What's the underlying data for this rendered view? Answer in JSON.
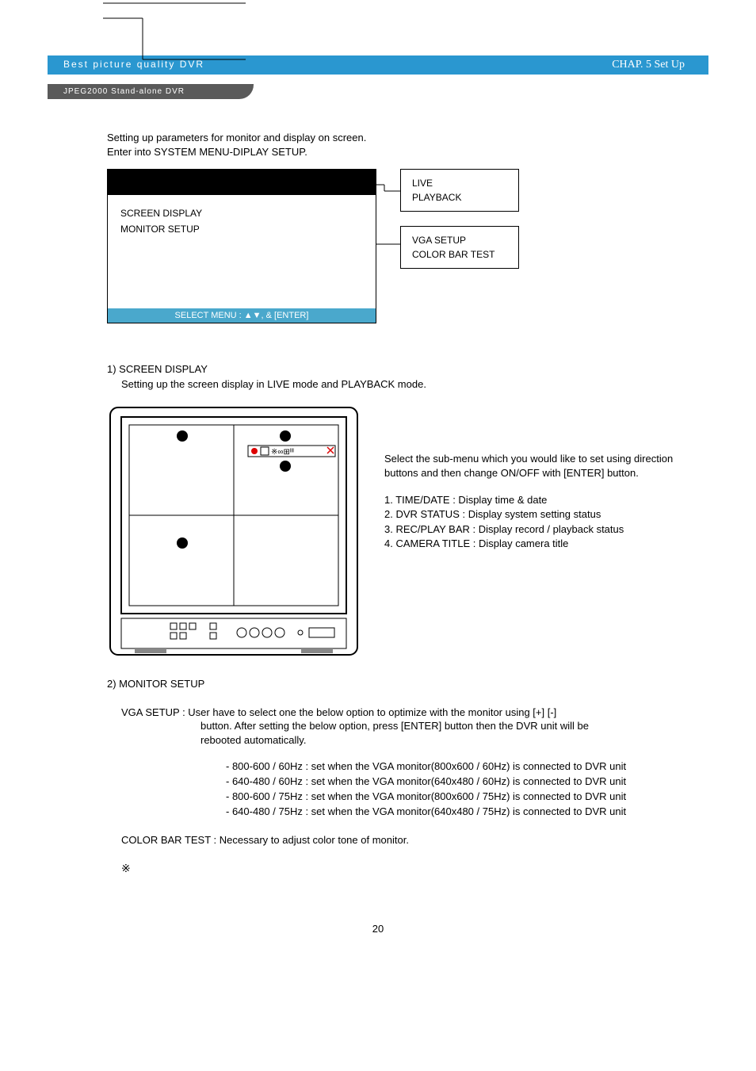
{
  "header": {
    "left": "Best picture quality DVR",
    "right": "CHAP.  5  Set Up",
    "sub": "JPEG2000 Stand-alone DVR"
  },
  "intro": {
    "line1": "Setting up parameters for monitor and display on screen.",
    "line2": "Enter into SYSTEM MENU-DIPLAY SETUP."
  },
  "menu_box": {
    "item1": "SCREEN DISPLAY",
    "item2": "MONITOR SETUP",
    "footer": "SELECT MENU : ▲▼, & [ENTER]"
  },
  "side_box1": {
    "line1": "LIVE",
    "line2": "PLAYBACK"
  },
  "side_box2": {
    "line1": "VGA SETUP",
    "line2": "COLOR BAR TEST"
  },
  "section1": {
    "heading": "1) SCREEN DISPLAY",
    "desc": "Setting up the screen display in LIVE mode and PLAYBACK mode.",
    "select_text": "Select the sub-menu which you would like to set using direction buttons and then change ON/OFF with [ENTER] button.",
    "list1": "1. TIME/DATE : Display time & date",
    "list2": "2. DVR STATUS : Display system setting status",
    "list3": "3. REC/PLAY BAR : Display record / playback status",
    "list4": "4. CAMERA TITLE : Display camera title"
  },
  "section2": {
    "heading": "2) MONITOR SETUP",
    "vga_intro": "VGA SETUP : User have to select one the below option to optimize with the monitor using  [+] [-]",
    "vga_line2": "button. After setting the below option, press [ENTER] button then the DVR unit will be",
    "vga_line3": "rebooted automatically.",
    "opt1": "- 800-600 / 60Hz : set when the VGA monitor(800x600 / 60Hz) is connected to DVR unit",
    "opt2": "- 640-480 / 60Hz : set when the VGA monitor(640x480 / 60Hz) is connected to DVR unit",
    "opt3": "- 800-600 / 75Hz : set when the VGA monitor(800x600 / 75Hz) is connected to DVR unit",
    "opt4": "- 640-480 / 75Hz : set when the VGA monitor(640x480 / 75Hz) is connected to DVR unit",
    "color_bar": "COLOR BAR TEST : Necessary to adjust color tone of monitor.",
    "note": "※"
  },
  "page_number": "20"
}
